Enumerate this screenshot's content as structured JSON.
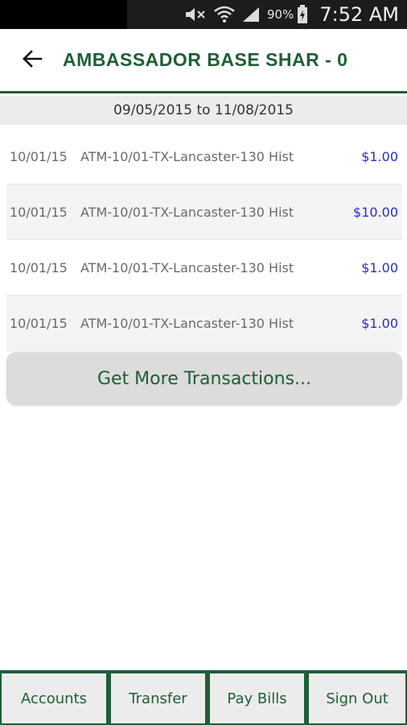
{
  "status_bar": {
    "battery_percent": "90%",
    "time": "7:52 AM",
    "icons": [
      "mute-icon",
      "wifi-icon",
      "signal-icon",
      "battery-icon"
    ]
  },
  "header": {
    "title": "AMBASSADOR BASE SHAR - 0",
    "back_icon": "arrow-left-icon"
  },
  "date_range": "09/05/2015 to 11/08/2015",
  "transactions": [
    {
      "date": "10/01/15",
      "description": "ATM-10/01-TX-Lancaster-130 Hist",
      "amount": "$1.00"
    },
    {
      "date": "10/01/15",
      "description": "ATM-10/01-TX-Lancaster-130 Hist",
      "amount": "$10.00"
    },
    {
      "date": "10/01/15",
      "description": "ATM-10/01-TX-Lancaster-130 Hist",
      "amount": "$1.00"
    },
    {
      "date": "10/01/15",
      "description": "ATM-10/01-TX-Lancaster-130 Hist",
      "amount": "$1.00"
    }
  ],
  "more_button": "Get More Transactions...",
  "bottom_nav": [
    {
      "label": "Accounts"
    },
    {
      "label": "Transfer"
    },
    {
      "label": "Pay Bills"
    },
    {
      "label": "Sign Out"
    }
  ],
  "colors": {
    "brand_green": "#1f5e36",
    "amount_blue": "#2a2ad0"
  }
}
